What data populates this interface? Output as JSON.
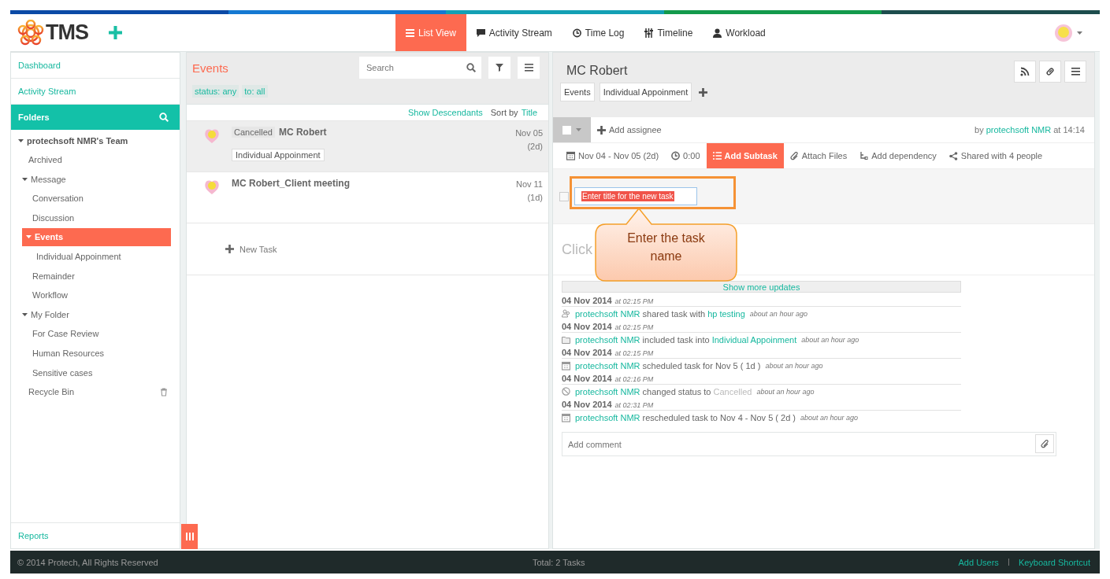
{
  "header": {
    "logo_text": "TMS",
    "nav": [
      {
        "label": "List View",
        "selected": true
      },
      {
        "label": "Activity Stream",
        "selected": false
      },
      {
        "label": "Time Log",
        "selected": false
      },
      {
        "label": "Timeline",
        "selected": false
      },
      {
        "label": "Workload",
        "selected": false
      }
    ]
  },
  "sidebar": {
    "links": [
      "Dashboard",
      "Activity Stream"
    ],
    "folders_title": "Folders",
    "tree": [
      {
        "label": "protechsoft NMR's Team",
        "expanded": true,
        "selected": false,
        "children": [
          {
            "label": "Archived",
            "kind": "folder",
            "selected": false
          },
          {
            "label": "Message",
            "kind": "folder",
            "expanded": true,
            "selected": false,
            "children": [
              {
                "label": "Conversation",
                "selected": false
              },
              {
                "label": "Discussion",
                "selected": false
              },
              {
                "label": "Events",
                "expanded": true,
                "selected": true,
                "children": [
                  {
                    "label": "Individual Appoinment",
                    "selected": false
                  }
                ]
              },
              {
                "label": "Remainder",
                "selected": false
              },
              {
                "label": "Workflow",
                "selected": false
              }
            ]
          },
          {
            "label": "My Folder",
            "kind": "folder",
            "expanded": true,
            "selected": false,
            "children": [
              {
                "label": "For Case Review",
                "selected": false
              },
              {
                "label": "Human Resources",
                "selected": false
              },
              {
                "label": "Sensitive cases",
                "selected": false
              }
            ]
          },
          {
            "label": "Recycle Bin",
            "kind": "bin",
            "selected": false
          }
        ]
      }
    ],
    "reports": "Reports"
  },
  "list": {
    "title": "Events",
    "search": {
      "placeholder": "Search"
    },
    "filters": [
      "status: any",
      "to: all"
    ],
    "show_descendants": "Show Descendants",
    "sort_label": "Sort by",
    "sort_value": "Title",
    "rows": [
      {
        "status": "Cancelled",
        "title": "MC Robert",
        "tag": "Individual Appoinment",
        "date": "Nov 05",
        "duration": "(2d)",
        "selected": true
      },
      {
        "title": "MC Robert_Client meeting",
        "date": "Nov 11",
        "duration": "(1d)",
        "selected": false
      }
    ],
    "new_task": "New Task"
  },
  "detail": {
    "title": "MC Robert",
    "tags": [
      "Events",
      "Individual Appoinment"
    ],
    "add_assignee": "Add assignee",
    "by": "by",
    "author": "protechsoft NMR",
    "at": "at 14:14",
    "toolbar": [
      {
        "kind": "date",
        "label": "Nov 04 - Nov 05 (2d)",
        "selected": false
      },
      {
        "kind": "clock",
        "label": "0:00",
        "selected": false
      },
      {
        "kind": "subtask",
        "label": "Add Subtask",
        "selected": true
      },
      {
        "kind": "attach",
        "label": "Attach Files",
        "selected": false
      },
      {
        "kind": "dependency",
        "label": "Add dependency",
        "selected": false
      },
      {
        "kind": "share",
        "label": "Shared with 4 people",
        "selected": false
      }
    ],
    "subtask_value": "Enter title for the new task",
    "description": "Click",
    "show_more": "Show more updates",
    "activity": [
      {
        "date": "04 Nov 2014",
        "time": "at 02:15 PM",
        "kind": "share",
        "parts": [
          {
            "kind": "link",
            "text": "protechsoft NMR"
          },
          {
            "kind": "text",
            "text": "shared task with"
          },
          {
            "kind": "link",
            "text": "hp testing"
          }
        ],
        "ago": "about an hour ago"
      },
      {
        "date": "04 Nov 2014",
        "time": "at 02:15 PM",
        "kind": "folder",
        "parts": [
          {
            "kind": "link",
            "text": "protechsoft NMR"
          },
          {
            "kind": "text",
            "text": "included task into"
          },
          {
            "kind": "link",
            "text": "Individual Appoinment"
          }
        ],
        "ago": "about an hour ago"
      },
      {
        "date": "04 Nov 2014",
        "time": "at 02:15 PM",
        "kind": "calendar",
        "parts": [
          {
            "kind": "link",
            "text": "protechsoft NMR"
          },
          {
            "kind": "text",
            "text": "scheduled task for Nov 5 ( 1d )"
          }
        ],
        "ago": "about an hour ago"
      },
      {
        "date": "04 Nov 2014",
        "time": "at 02:16 PM",
        "kind": "status",
        "parts": [
          {
            "kind": "link",
            "text": "protechsoft NMR"
          },
          {
            "kind": "text",
            "text": "changed status to"
          },
          {
            "kind": "muted",
            "text": "Cancelled"
          }
        ],
        "ago": "about an hour ago"
      },
      {
        "date": "04 Nov 2014",
        "time": "at 02:31 PM",
        "kind": "calendar",
        "parts": [
          {
            "kind": "link",
            "text": "protechsoft NMR"
          },
          {
            "kind": "text",
            "text": "rescheduled task to Nov 4 - Nov 5 ( 2d )"
          }
        ],
        "ago": "about an hour ago"
      }
    ],
    "comment": {
      "placeholder": "Add comment"
    }
  },
  "annotation": {
    "text": "Enter the task name"
  },
  "footer": {
    "copyright": "© 2014 Protech, All Rights Reserved",
    "total": "Total: 2 Tasks",
    "links": [
      "Add Users",
      "Keyboard Shortcut"
    ]
  }
}
